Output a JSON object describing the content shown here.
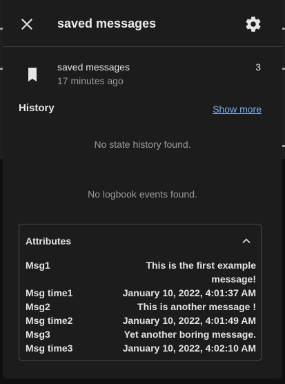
{
  "dialog": {
    "title": "saved messages"
  },
  "entity": {
    "name": "saved messages",
    "last_changed": "17 minutes ago",
    "state": "3"
  },
  "history": {
    "title": "History",
    "show_more": "Show more",
    "empty_state": "No state history found.",
    "logbook_empty": "No logbook events found."
  },
  "attributes": {
    "title": "Attributes",
    "rows": [
      {
        "key": "Msg1",
        "value": "This is the first example message!"
      },
      {
        "key": "Msg time1",
        "value": "January 10, 2022, 4:01:37 AM"
      },
      {
        "key": "Msg2",
        "value": "This is another message !"
      },
      {
        "key": "Msg time2",
        "value": "January 10, 2022, 4:01:49 AM"
      },
      {
        "key": "Msg3",
        "value": "Yet another boring message."
      },
      {
        "key": "Msg time3",
        "value": "January 10, 2022, 4:02:10 AM"
      }
    ]
  },
  "icons": {
    "close": "close-icon",
    "settings": "gear-icon",
    "entity": "bookmark-icon",
    "collapse": "chevron-up-icon"
  },
  "colors": {
    "background": "#1c1c1c",
    "link": "#7aaee6",
    "muted_text": "#9a9a9a"
  }
}
